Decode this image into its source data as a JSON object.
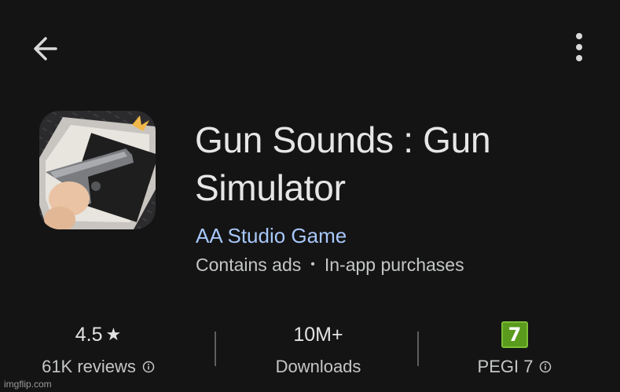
{
  "app": {
    "title": "Gun Sounds : Gun Simulator",
    "developer": "AA Studio Game",
    "meta": {
      "ads": "Contains ads",
      "separator": "•",
      "purchases": "In-app purchases"
    },
    "icon_name": "app-icon-gun"
  },
  "stats": {
    "rating": {
      "value": "4.5",
      "star": "★",
      "label": "61K reviews"
    },
    "downloads": {
      "value": "10M+",
      "label": "Downloads"
    },
    "pegi": {
      "badge": "7",
      "label": "PEGI 7"
    }
  },
  "colors": {
    "background": "#141414",
    "developer_link": "#a8c7fa",
    "pegi_green": "#5a9a1d"
  },
  "watermark": "imgflip.com"
}
